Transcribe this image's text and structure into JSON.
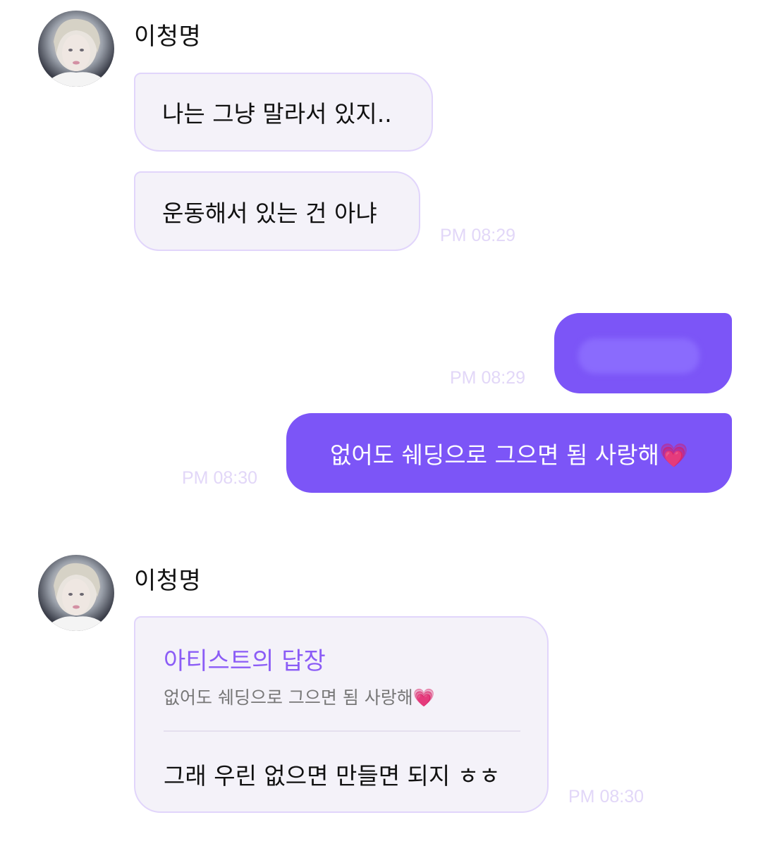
{
  "thread": {
    "group1": {
      "sender_name": "이청명",
      "messages": [
        "나는 그냥 말라서 있지..",
        "운동해서 있는 건 아냐"
      ],
      "time": "PM 08:29"
    },
    "outgoing": [
      {
        "text": "",
        "time": "PM 08:29",
        "redacted": true
      },
      {
        "text": "없어도 쉐딩으로 그으면 됨 사랑해💗",
        "time": "PM 08:30"
      }
    ],
    "group2": {
      "sender_name": "이청명",
      "reply_header": "아티스트의 답장",
      "quoted_text": "없어도 쉐딩으로 그으면 됨 사랑해💗",
      "message": "그래 우린 없으면 만들면 되지 ㅎㅎ",
      "time": "PM 08:30"
    }
  },
  "colors": {
    "outgoing_bubble": "#7c55f7",
    "incoming_bubble_bg": "#f4f2f9",
    "incoming_bubble_border": "#e1d5fb",
    "reply_header": "#8b5cf6",
    "timestamp": "#e2d7f8"
  },
  "icons": {
    "avatar": "artist-profile-photo"
  }
}
